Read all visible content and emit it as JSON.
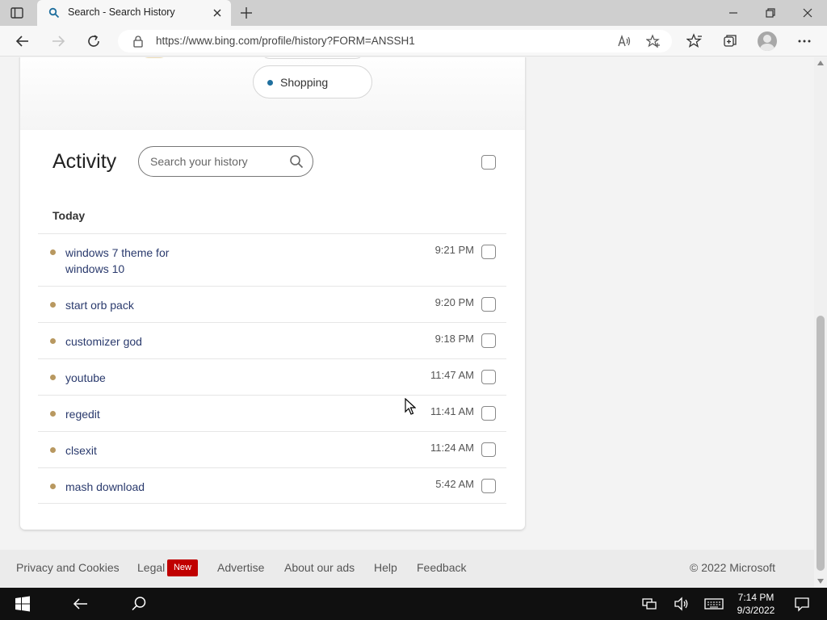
{
  "browser": {
    "tab_title": "Search - Search History",
    "url": "https://www.bing.com/profile/history?FORM=ANSSH1"
  },
  "interests": {
    "visible_pill": "Shopping"
  },
  "activity": {
    "title": "Activity",
    "search_placeholder": "Search your history",
    "section_heading": "Today",
    "items": [
      {
        "query": "windows 7 theme for windows 10",
        "time": "9:21 PM"
      },
      {
        "query": "start orb pack",
        "time": "9:20 PM"
      },
      {
        "query": "customizer god",
        "time": "9:18 PM"
      },
      {
        "query": "youtube",
        "time": "11:47 AM"
      },
      {
        "query": "regedit",
        "time": "11:41 AM"
      },
      {
        "query": "clsexit",
        "time": "11:24 AM"
      },
      {
        "query": "mash download",
        "time": "5:42 AM"
      }
    ]
  },
  "footer": {
    "privacy": "Privacy and Cookies",
    "legal": "Legal",
    "new_badge": "New",
    "advertise": "Advertise",
    "about_ads": "About our ads",
    "help": "Help",
    "feedback": "Feedback",
    "copyright": "© 2022 Microsoft"
  },
  "taskbar": {
    "time": "7:14 PM",
    "date": "9/3/2022"
  },
  "colors": {
    "link": "#2a3a6d",
    "item_dot": "#b89860",
    "pill_dot": "#1f6f9e",
    "new_badge": "#c00000"
  }
}
